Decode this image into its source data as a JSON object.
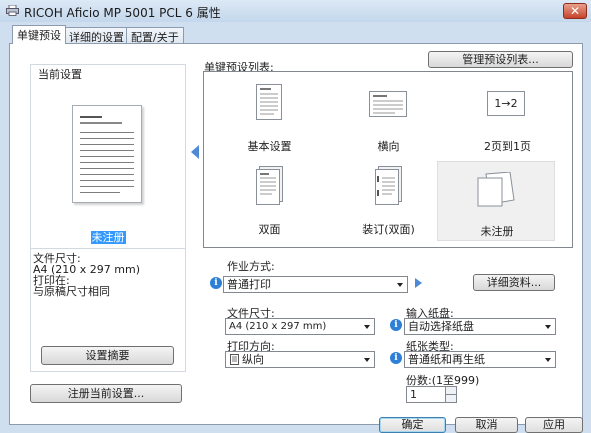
{
  "window": {
    "title": "RICOH Aficio MP 5001 PCL 6 属性",
    "close_symbol": "✕"
  },
  "tabs": [
    {
      "label": "单键预设"
    },
    {
      "label": "详细的设置"
    },
    {
      "label": "配置/关于"
    }
  ],
  "current": {
    "group_label": "当前设置",
    "profile_name": "未注册",
    "info": [
      "文件尺寸:",
      " A4 (210 x 297 mm)",
      "打印在:",
      " 与原稿尺寸相同"
    ],
    "summary_button": "设置摘要",
    "register_button": "注册当前设置..."
  },
  "presets": {
    "label": "单键预设列表:",
    "manage_button": "管理预设列表...",
    "items": [
      {
        "label": "基本设置",
        "icon": "page-portrait-icon"
      },
      {
        "label": "横向",
        "icon": "page-landscape-icon"
      },
      {
        "label": "2页到1页",
        "icon": "two-in-one-icon",
        "icon_text": "1→2"
      },
      {
        "label": "双面",
        "icon": "duplex-icon"
      },
      {
        "label": "装订(双面)",
        "icon": "staple-duplex-icon"
      },
      {
        "label": "未注册",
        "icon": "blank-pages-icon"
      }
    ]
  },
  "settings": {
    "job_type_label": "作业方式:",
    "job_type_value": "普通打印",
    "details_button": "详细资料...",
    "paper_size_label": "文件尺寸:",
    "paper_size_value": "A4 (210 x 297 mm)",
    "orientation_label": "打印方向:",
    "orientation_value": "纵向",
    "input_tray_label": "输入纸盘:",
    "input_tray_value": "自动选择纸盘",
    "paper_type_label": "纸张类型:",
    "paper_type_value": "普通纸和再生纸",
    "copies_label": "份数:(1至999)",
    "copies_value": "1"
  },
  "dialog_buttons": {
    "ok": "确定",
    "cancel": "取消",
    "apply": "应用"
  },
  "colors": {
    "accent": "#3399ff",
    "arrow_blue": "#4d8ad6",
    "close_red": "#c5432c"
  }
}
